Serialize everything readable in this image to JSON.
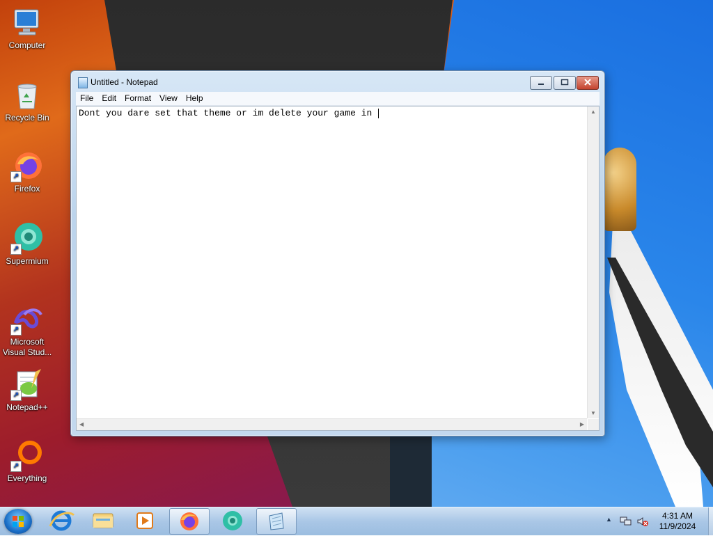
{
  "desktop_icons": [
    {
      "label": "Computer",
      "icon": "computer-icon",
      "shortcut": false
    },
    {
      "label": "Recycle Bin",
      "icon": "recycle-bin-icon",
      "shortcut": false
    },
    {
      "label": "Firefox",
      "icon": "firefox-icon",
      "shortcut": true
    },
    {
      "label": "Supermium",
      "icon": "supermium-icon",
      "shortcut": true
    },
    {
      "label": "Microsoft Visual Stud...",
      "icon": "visual-studio-icon",
      "shortcut": true
    },
    {
      "label": "Notepad++",
      "icon": "notepad-plus-plus-icon",
      "shortcut": true
    },
    {
      "label": "Everything",
      "icon": "everything-search-icon",
      "shortcut": true
    }
  ],
  "window": {
    "title": "Untitled - Notepad",
    "menu": [
      "File",
      "Edit",
      "Format",
      "View",
      "Help"
    ],
    "content": "Dont you dare set that theme or im delete your game in "
  },
  "taskbar": {
    "pinned": [
      {
        "icon": "internet-explorer-icon"
      },
      {
        "icon": "file-explorer-icon"
      },
      {
        "icon": "media-player-icon"
      },
      {
        "icon": "firefox-icon"
      },
      {
        "icon": "supermium-icon"
      },
      {
        "icon": "notepad-icon",
        "active": true
      }
    ],
    "time": "4:31 AM",
    "date": "11/9/2024"
  },
  "colors": {
    "accent": "#1b6fc8",
    "close_button": "#c4432e"
  }
}
